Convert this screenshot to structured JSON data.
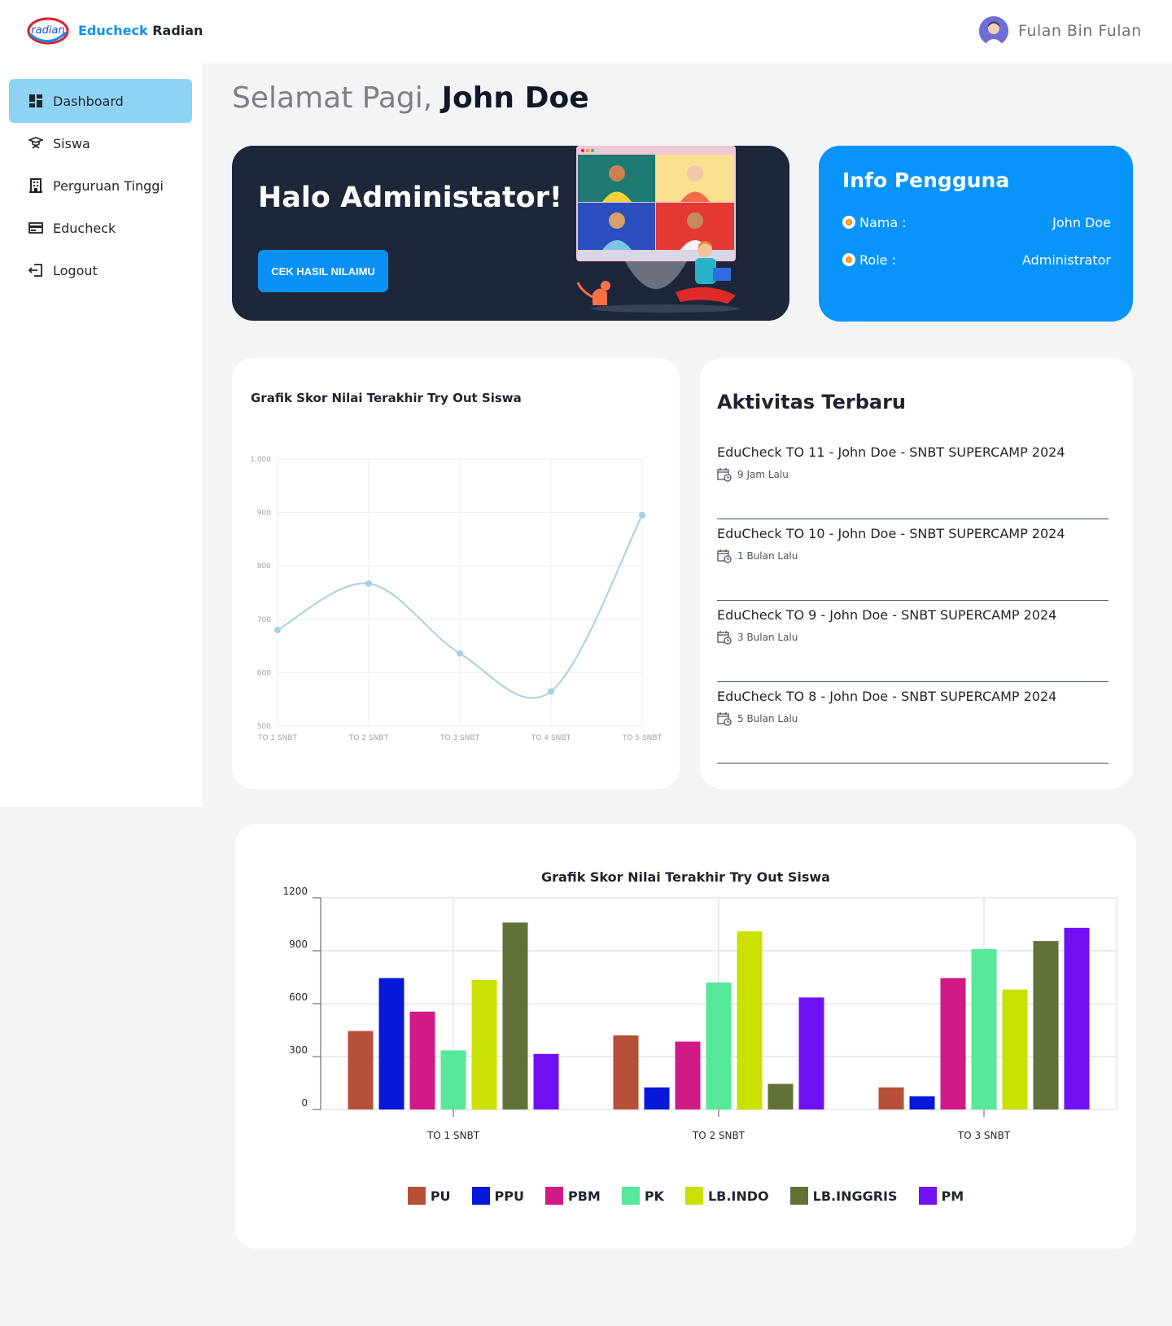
{
  "header": {
    "brand_part1": "Educheck",
    "brand_part2": "Radian",
    "user_name": "Fulan Bin Fulan"
  },
  "sidebar": {
    "items": [
      {
        "label": "Dashboard",
        "icon": "dashboard-icon",
        "active": true
      },
      {
        "label": "Siswa",
        "icon": "graduation-cap-icon",
        "active": false
      },
      {
        "label": "Perguruan Tinggi",
        "icon": "building-icon",
        "active": false
      },
      {
        "label": "Educheck",
        "icon": "card-icon",
        "active": false
      },
      {
        "label": "Logout",
        "icon": "logout-icon",
        "active": false
      }
    ]
  },
  "greeting": {
    "prefix": "Selamat Pagi,",
    "name": "John Doe"
  },
  "hero": {
    "title": "Halo Administator!",
    "button_label": "CEK HASIL NILAIMU"
  },
  "info": {
    "title": "Info Pengguna",
    "rows": [
      {
        "label": "Nama :",
        "value": "John Doe"
      },
      {
        "label": "Role :",
        "value": "Administrator"
      }
    ]
  },
  "activity": {
    "title": "Aktivitas Terbaru",
    "items": [
      {
        "title": "EduCheck TO 11 - John Doe - SNBT SUPERCAMP 2024",
        "time": "9 Jam Lalu"
      },
      {
        "title": "EduCheck TO 10 - John Doe - SNBT SUPERCAMP 2024",
        "time": "1 Bulan Lalu"
      },
      {
        "title": "EduCheck TO 9 - John Doe - SNBT SUPERCAMP 2024",
        "time": "3 Bulan Lalu"
      },
      {
        "title": "EduCheck TO 8 - John Doe - SNBT SUPERCAMP 2024",
        "time": "5 Bulan Lalu"
      }
    ]
  },
  "colors": {
    "accent": "#0a8ff2",
    "hero_bg": "#1e263a",
    "sidebar_active": "#8fd3f4",
    "line": "#a9cfe3"
  },
  "chart_data": [
    {
      "type": "line",
      "title": "Grafik Skor Nilai  Terakhir Try Out Siswa",
      "categories": [
        "TO 1 SNBT",
        "TO 2 SNBT",
        "TO 3 SNBT",
        "TO 4 SNBT",
        "TO 5 SNBT"
      ],
      "values": [
        680,
        767,
        636,
        565,
        895
      ],
      "ylim": [
        500,
        1000
      ],
      "yticks": [
        "500",
        "600",
        "700",
        "800",
        "900",
        "1,000"
      ],
      "grid": true,
      "smooth": true,
      "color": "#a9cfe3"
    },
    {
      "type": "bar",
      "title": "Grafik Skor Nilai  Terakhir Try Out Siswa",
      "categories": [
        "TO 1 SNBT",
        "TO 2 SNBT",
        "TO 3 SNBT"
      ],
      "ylim": [
        0,
        1200
      ],
      "yticks": [
        "0",
        "300",
        "600",
        "900",
        "1200"
      ],
      "grid": true,
      "legend": "bottom",
      "series": [
        {
          "name": "PU",
          "color": "#b65038",
          "values": [
            445,
            420,
            125
          ]
        },
        {
          "name": "PPU",
          "color": "#0718d8",
          "values": [
            745,
            125,
            75
          ]
        },
        {
          "name": "PBM",
          "color": "#d01a86",
          "values": [
            555,
            385,
            745
          ]
        },
        {
          "name": "PK",
          "color": "#57e89a",
          "values": [
            335,
            720,
            910
          ]
        },
        {
          "name": "LB.INDO",
          "color": "#c9e000",
          "values": [
            735,
            1010,
            680
          ]
        },
        {
          "name": "LB.INGGRIS",
          "color": "#617238",
          "values": [
            1060,
            145,
            955
          ]
        },
        {
          "name": "PM",
          "color": "#7110f4",
          "values": [
            315,
            635,
            1030
          ]
        }
      ]
    }
  ]
}
